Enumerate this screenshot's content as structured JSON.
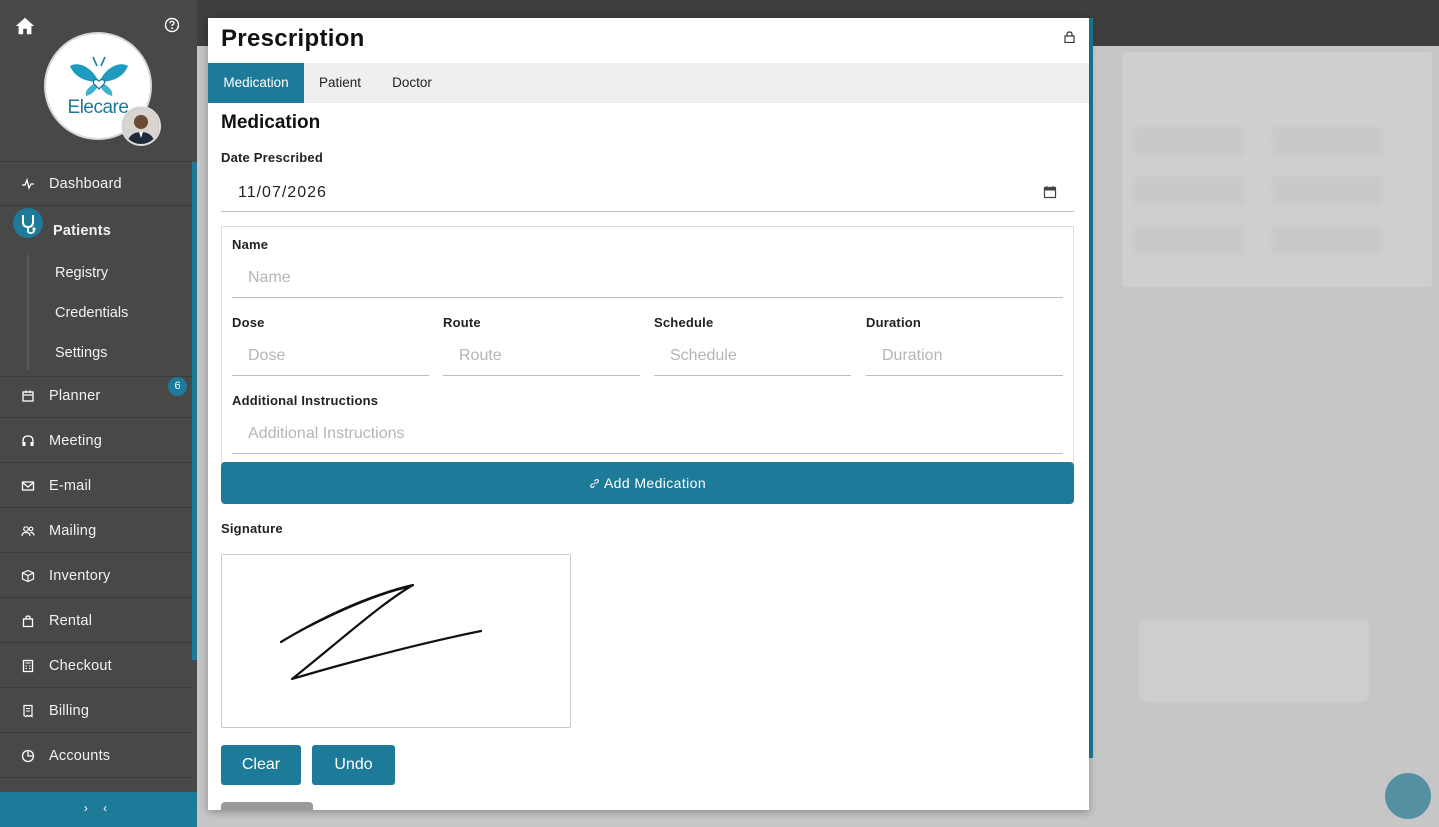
{
  "sidebar": {
    "logo_text": "Elecare",
    "nav": [
      {
        "label": "Dashboard",
        "icon": "pulse-icon"
      },
      {
        "label": "Patients",
        "icon": "stethoscope-icon"
      },
      {
        "label": "Planner",
        "icon": "calendar-icon",
        "badge": "6"
      },
      {
        "label": "Meeting",
        "icon": "headphones-icon"
      },
      {
        "label": "E-mail",
        "icon": "mail-icon"
      },
      {
        "label": "Mailing",
        "icon": "users-icon"
      },
      {
        "label": "Inventory",
        "icon": "box-icon"
      },
      {
        "label": "Rental",
        "icon": "bag-icon"
      },
      {
        "label": "Checkout",
        "icon": "register-icon"
      },
      {
        "label": "Billing",
        "icon": "receipt-icon"
      },
      {
        "label": "Accounts",
        "icon": "pie-icon"
      }
    ],
    "patients_sub": [
      "Registry",
      "Credentials",
      "Settings"
    ],
    "collapse_label": "› ‹"
  },
  "modal": {
    "title": "Prescription",
    "tabs": [
      "Medication",
      "Patient",
      "Doctor"
    ],
    "active_tab": "Medication",
    "section_title": "Medication",
    "date_label": "Date Prescribed",
    "date_value": "11/07/2026",
    "name_label": "Name",
    "name_placeholder": "Name",
    "dose_label": "Dose",
    "dose_placeholder": "Dose",
    "route_label": "Route",
    "route_placeholder": "Route",
    "schedule_label": "Schedule",
    "schedule_placeholder": "Schedule",
    "duration_label": "Duration",
    "duration_placeholder": "Duration",
    "instructions_label": "Additional Instructions",
    "instructions_placeholder": "Additional Instructions",
    "add_button": "Add Medication",
    "signature_label": "Signature",
    "clear_button": "Clear",
    "undo_button": "Undo"
  },
  "colors": {
    "accent": "#1d7a98",
    "sidebar_bg": "#484848"
  }
}
